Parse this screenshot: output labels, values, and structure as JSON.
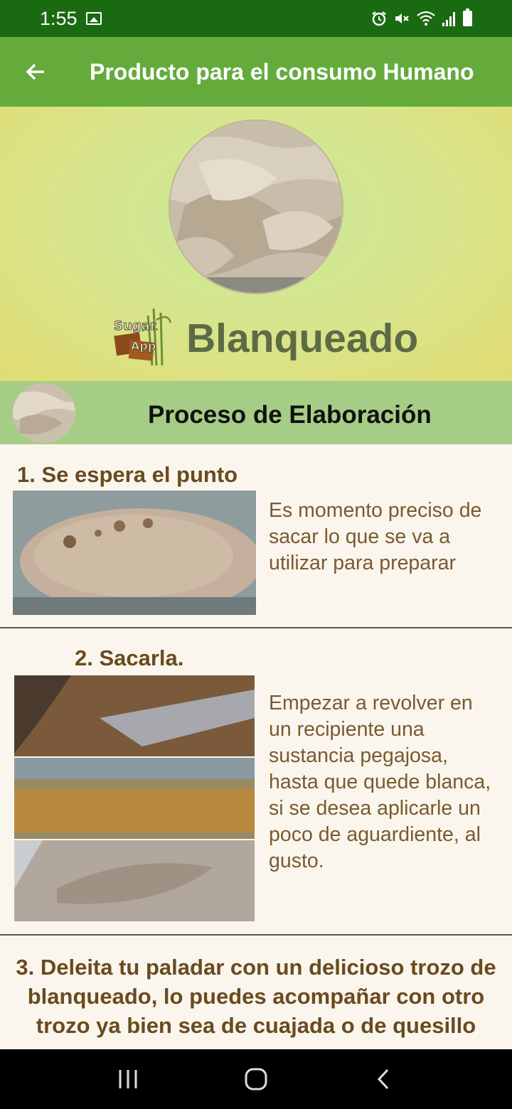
{
  "status_bar": {
    "time": "1:55"
  },
  "app_bar": {
    "title": "Producto para el consumo Humano"
  },
  "hero": {
    "title": "Blanqueado",
    "logo_text_1": "Sugar",
    "logo_text_2": "App"
  },
  "section": {
    "title": "Proceso de Elaboración"
  },
  "steps": [
    {
      "title": "1. Se espera el punto",
      "text": "Es momento preciso de sacar lo que se va a utilizar para preparar"
    },
    {
      "title": "2. Sacarla.",
      "text": "Empezar a revolver en un recipiente una sustancia pegajosa, hasta que quede blanca, si se desea aplicarle un poco de aguardiente, al gusto."
    },
    {
      "title": "3. Deleita tu paladar con un delicioso trozo de blanqueado, lo puedes acompañar con otro trozo ya bien sea de cuajada o de quesillo"
    }
  ],
  "colors": {
    "status_bar": "#1a6a12",
    "app_bar": "#64ab3c",
    "section_bar": "#a6cd86",
    "title_brown": "#6a4a1e",
    "hero_title": "#5d6b45"
  },
  "icons": [
    "gallery-icon",
    "alarm-icon",
    "mute-icon",
    "wifi-icon",
    "signal-icon",
    "battery-icon",
    "back-arrow-icon",
    "recents-icon",
    "home-icon",
    "back-nav-icon"
  ]
}
